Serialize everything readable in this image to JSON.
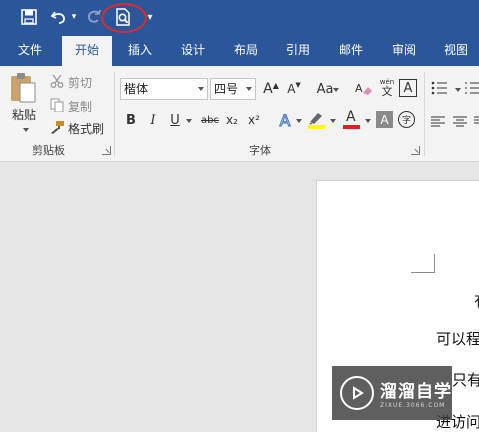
{
  "quick_access": {
    "undo_dropdown": "▾",
    "customize_dropdown": "▾"
  },
  "tabs": [
    {
      "label": "文件"
    },
    {
      "label": "开始"
    },
    {
      "label": "插入"
    },
    {
      "label": "设计"
    },
    {
      "label": "布局"
    },
    {
      "label": "引用"
    },
    {
      "label": "邮件"
    },
    {
      "label": "审阅"
    },
    {
      "label": "视图"
    }
  ],
  "active_tab": "开始",
  "clipboard": {
    "paste_label": "粘贴",
    "cut_label": "剪切",
    "copy_label": "复制",
    "format_painter_label": "格式刷",
    "group_label": "剪贴板"
  },
  "font": {
    "font_name": "楷体",
    "font_size": "四号",
    "group_label": "字体",
    "bold": "B",
    "italic": "I",
    "underline": "U",
    "strikethrough": "abc",
    "subscript": "x₂",
    "superscript": "x²",
    "grow_font": "A",
    "shrink_font": "A",
    "change_case": "Aa",
    "phonetic_top": "wén",
    "phonetic_bottom": "文",
    "char_border": "A",
    "text_effects": "A",
    "font_color": "A",
    "char_shading": "A",
    "enclose_char": "字"
  },
  "colors": {
    "accent": "#2b579a",
    "highlight": "#ffff00",
    "font_color": "#e02020",
    "annotation_ring": "#e02a2a"
  },
  "document": {
    "lines": [
      "有",
      "可以程",
      "只有",
      "进访问"
    ]
  },
  "watermark": {
    "title": "溜溜自学",
    "subtitle": "ZIXUE.3066.COM"
  }
}
